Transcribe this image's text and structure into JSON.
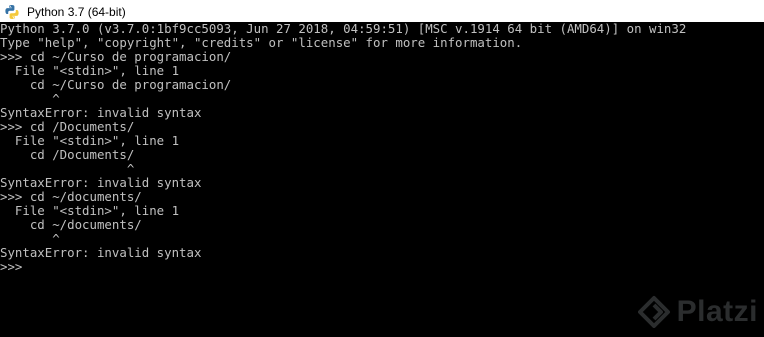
{
  "window": {
    "title": "Python 3.7 (64-bit)",
    "icon": "python-icon"
  },
  "console": {
    "lines": [
      "Python 3.7.0 (v3.7.0:1bf9cc5093, Jun 27 2018, 04:59:51) [MSC v.1914 64 bit (AMD64)] on win32",
      "Type \"help\", \"copyright\", \"credits\" or \"license\" for more information.",
      ">>> cd ~/Curso de programacion/",
      "  File \"<stdin>\", line 1",
      "    cd ~/Curso de programacion/",
      "       ^",
      "SyntaxError: invalid syntax",
      ">>> cd /Documents/",
      "  File \"<stdin>\", line 1",
      "    cd /Documents/",
      "                 ^",
      "SyntaxError: invalid syntax",
      ">>> cd ~/documents/",
      "  File \"<stdin>\", line 1",
      "    cd ~/documents/",
      "       ^",
      "SyntaxError: invalid syntax",
      ">>>"
    ]
  },
  "watermark": {
    "text": "Platzi",
    "icon": "platzi-logo-icon"
  },
  "colors": {
    "console_background": "#000000",
    "console_text": "#c0c0c0",
    "titlebar_background": "#ffffff"
  }
}
